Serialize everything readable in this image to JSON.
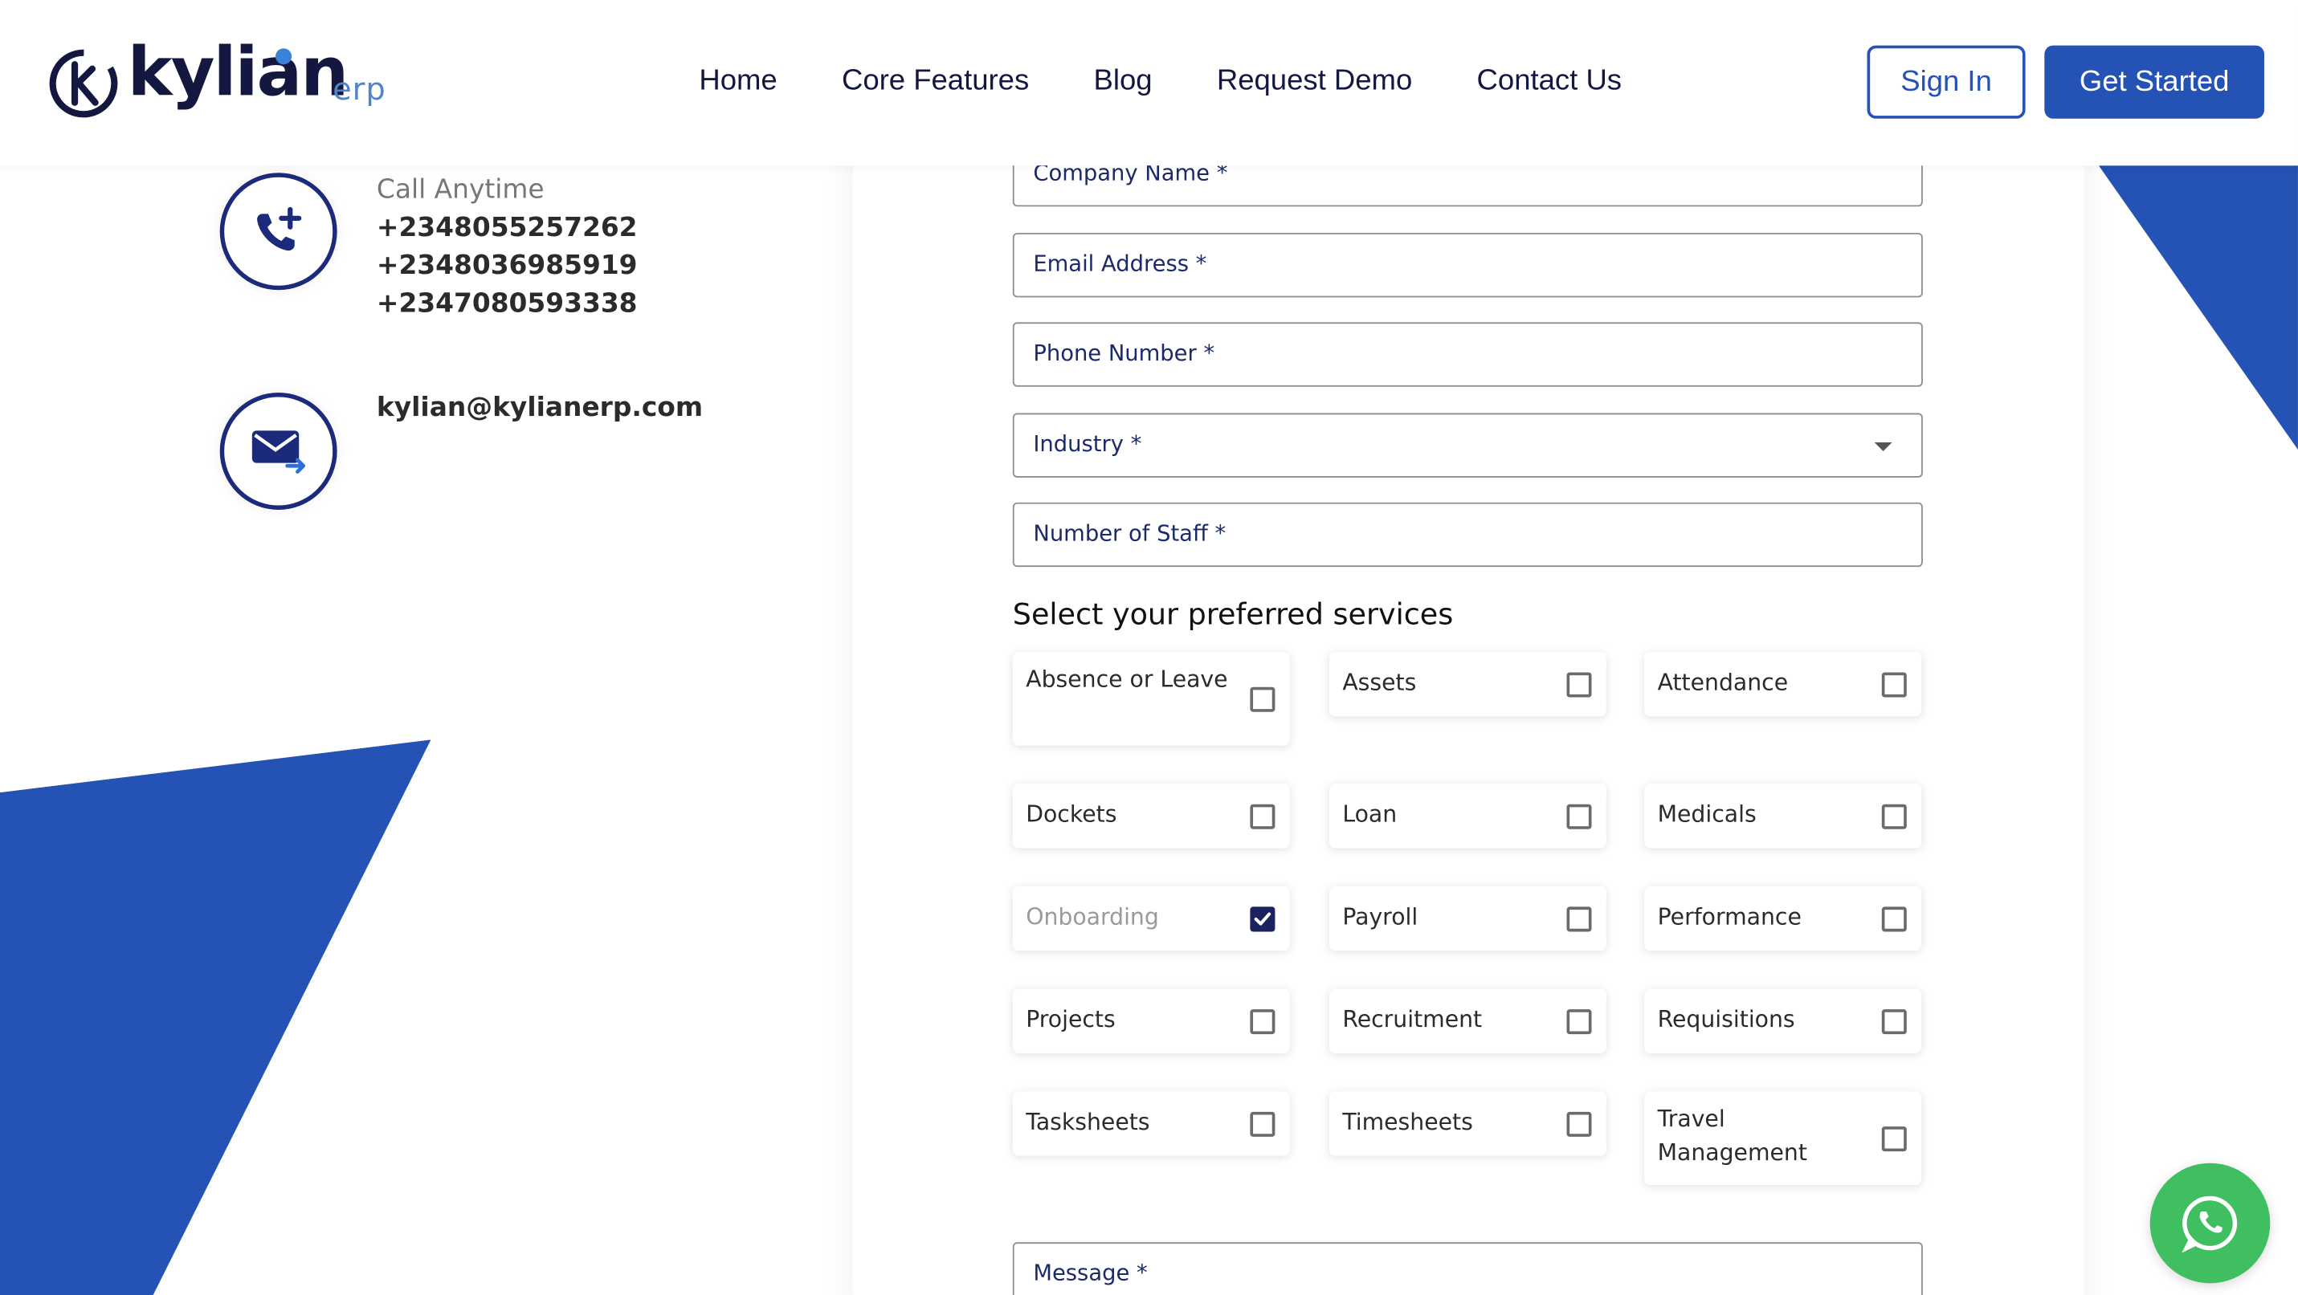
{
  "header": {
    "logo_word": "kylian",
    "logo_suffix": "erp",
    "nav": [
      "Home",
      "Core Features",
      "Blog",
      "Request Demo",
      "Contact Us"
    ],
    "sign_in": "Sign In",
    "get_started": "Get Started"
  },
  "contact": {
    "call_label": "Call Anytime",
    "phones": [
      "+2348055257262",
      "+2348036985919",
      "+2347080593338"
    ],
    "email": "kylian@kylianerp.com"
  },
  "form": {
    "company_name": "Company Name *",
    "email": "Email Address *",
    "phone": "Phone Number *",
    "industry": "Industry *",
    "staff": "Number of Staff *",
    "services_title": "Select your preferred services",
    "services": [
      {
        "label": "Absence or Leave",
        "checked": false
      },
      {
        "label": "Assets",
        "checked": false
      },
      {
        "label": "Attendance",
        "checked": false
      },
      {
        "label": "Dockets",
        "checked": false
      },
      {
        "label": "Loan",
        "checked": false
      },
      {
        "label": "Medicals",
        "checked": false
      },
      {
        "label": "Onboarding",
        "checked": true
      },
      {
        "label": "Payroll",
        "checked": false
      },
      {
        "label": "Performance",
        "checked": false
      },
      {
        "label": "Projects",
        "checked": false
      },
      {
        "label": "Recruitment",
        "checked": false
      },
      {
        "label": "Requisitions",
        "checked": false
      },
      {
        "label": "Tasksheets",
        "checked": false
      },
      {
        "label": "Timesheets",
        "checked": false
      },
      {
        "label": "Travel Management",
        "checked": false
      }
    ],
    "message": "Message *"
  },
  "colors": {
    "brand_blue": "#2452b5",
    "navy": "#1b2260",
    "whatsapp": "#3fbf5f"
  }
}
